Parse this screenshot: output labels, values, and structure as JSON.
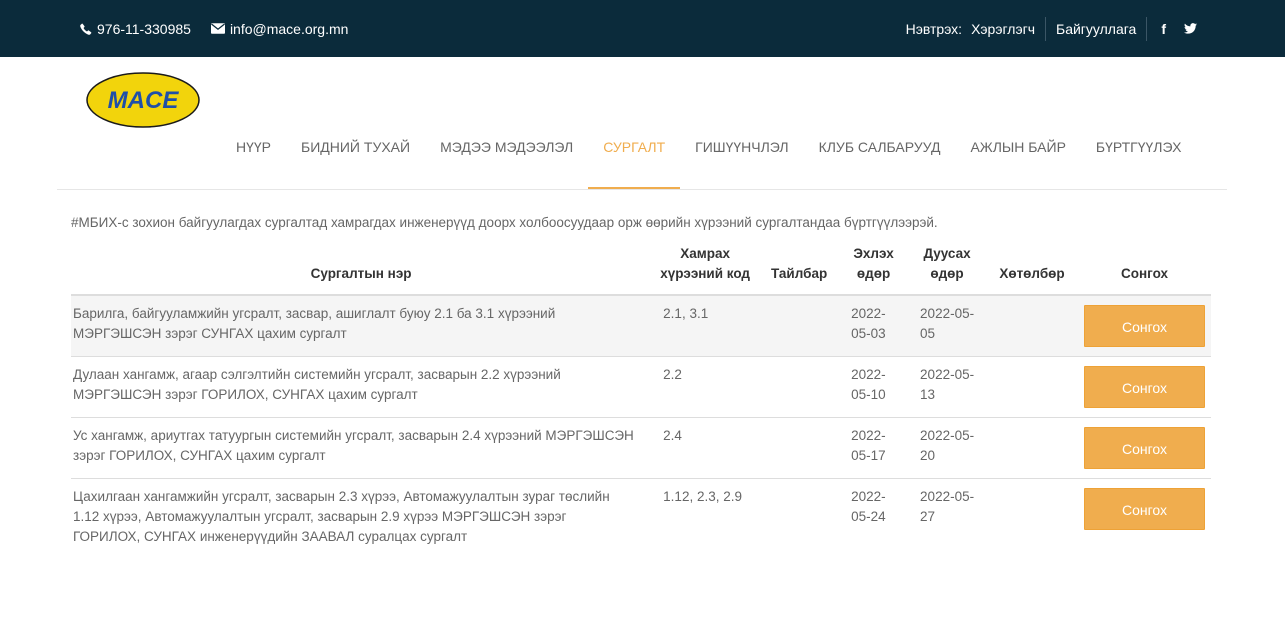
{
  "topbar": {
    "phone": "976-11-330985",
    "email": "info@mace.org.mn",
    "login_label": "Нэвтрэх:",
    "user_link": "Хэрэглэгч",
    "org_link": "Байгууллага",
    "facebook": "f",
    "twitter_icon": "twitter-icon"
  },
  "logo": {
    "text": "MACE",
    "colors": {
      "fill": "#f2d40c",
      "text": "#1f4fa8"
    }
  },
  "nav": {
    "items": [
      {
        "label": "НҮҮР"
      },
      {
        "label": "БИДНИЙ ТУХАЙ"
      },
      {
        "label": "МЭДЭЭ МЭДЭЭЛЭЛ"
      },
      {
        "label": "СУРГАЛТ"
      },
      {
        "label": "ГИШҮҮНЧЛЭЛ"
      },
      {
        "label": "КЛУБ САЛБАРУУД"
      },
      {
        "label": "АЖЛЫН БАЙР"
      },
      {
        "label": "БҮРТГҮҮЛЭХ"
      }
    ],
    "active": "СУРГАЛТ"
  },
  "intro": "#МБИХ-с зохион байгуулагдах сургалтад хамрагдах инженерүүд доорх холбоосуудаар орж өөрийн хүрээний сургалтандаа бүртгүүлээрэй.",
  "table": {
    "headers": {
      "name": "Сургалтын нэр",
      "code": "Хамрах хүрээний код",
      "note": "Тайлбар",
      "start": "Эхлэх өдөр",
      "end": "Дуусах өдөр",
      "program": "Хөтөлбөр",
      "select": "Сонгох"
    },
    "rows": [
      {
        "name": "Барилга, байгууламжийн угсралт, засвар, ашиглалт буюу 2.1 ба 3.1 хүрээний МЭРГЭШСЭН зэрэг СУНГАХ цахим сургалт",
        "code": "2.1, 3.1",
        "note": "",
        "start": "2022-05-03",
        "end": "2022-05-05",
        "program": "",
        "button": "Сонгох"
      },
      {
        "name": "Дулаан хангамж, агаар сэлгэлтийн системийн угсралт, засварын 2.2 хүрээний МЭРГЭШСЭН зэрэг ГОРИЛОХ, СУНГАХ цахим сургалт",
        "code": "2.2",
        "note": "",
        "start": "2022-05-10",
        "end": "2022-05-13",
        "program": "",
        "button": "Сонгох"
      },
      {
        "name": "Ус хангамж, ариутгах татуургын системийн угсралт, засварын 2.4 хүрээний МЭРГЭШСЭН зэрэг ГОРИЛОХ, СУНГАХ цахим сургалт",
        "code": "2.4",
        "note": "",
        "start": "2022-05-17",
        "end": "2022-05-20",
        "program": "",
        "button": "Сонгох"
      },
      {
        "name": "Цахилгаан хангамжийн угсралт, засварын 2.3 хүрээ, Автомажуулалтын зураг төслийн 1.12 хүрээ, Автомажуулалтын угсралт, засварын 2.9 хүрээ МЭРГЭШСЭН зэрэг ГОРИЛОХ, СУНГАХ инженерүүдийн ЗААВАЛ суралцах сургалт",
        "code": "1.12, 2.3, 2.9",
        "note": "",
        "start": "2022-05-24",
        "end": "2022-05-27",
        "program": "",
        "button": "Сонгох"
      }
    ]
  },
  "colors": {
    "topbar": "#0b2b3b",
    "accent": "#f0ad4e"
  }
}
